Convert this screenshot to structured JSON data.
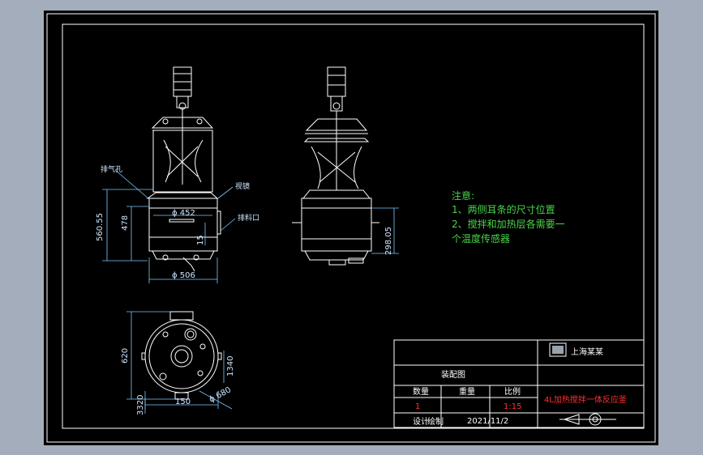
{
  "notes": {
    "title": "注意:",
    "line1": "1、两侧耳条的尺寸位置",
    "line2": "2、搅拌和加热层各需要一",
    "line3": "个温度传感器"
  },
  "dims_front": {
    "d452": "ϕ 452",
    "d506": "ϕ 506",
    "h560": "560.55",
    "h478": "478",
    "h15": "15"
  },
  "dims_side": {
    "h298": "298.05"
  },
  "dims_top": {
    "h620": "620",
    "w150": "150",
    "d680": "ϕ 680",
    "h1340": "1340",
    "h3320": "3320"
  },
  "labels": {
    "vent": "排气孔",
    "sight": "视镜",
    "outlet": "排料口"
  },
  "title_block": {
    "company": "上海某某",
    "drawing_type": "装配图",
    "col_qty": "数量",
    "col_weight": "重量",
    "col_scale": "比例",
    "qty_val": "1",
    "scale_val": "1:15",
    "product_name": "4L加热搅拌一体反应釜",
    "design_label": "设计",
    "drawn_label": "绘制",
    "date": "2021/11/2"
  },
  "colors": {
    "background": "#a4adbb",
    "drawing": "#000000",
    "line": "#ffffff",
    "dimension": "#7ec8ff",
    "notes": "#4cd34c",
    "highlight": "#ff3030"
  }
}
